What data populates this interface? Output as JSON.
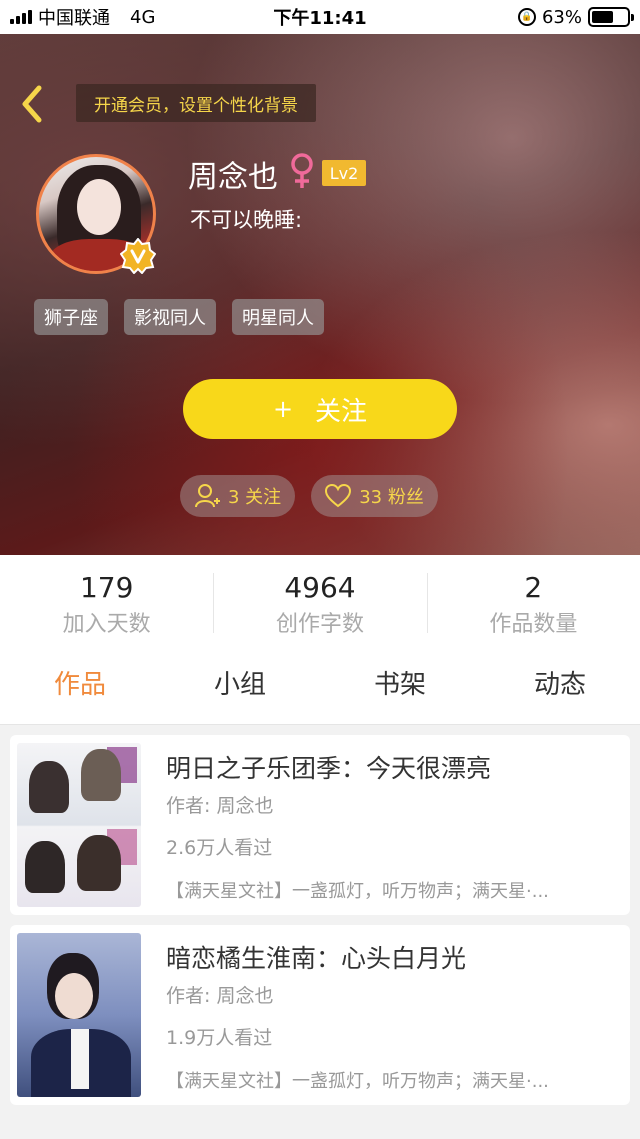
{
  "status_bar": {
    "carrier": "中国联通",
    "network": "4G",
    "time": "下午11:41",
    "battery_pct": "63%",
    "battery_level": 0.63
  },
  "header": {
    "vip_banner": "开通会员，设置个性化背景",
    "username": "周念也",
    "level": "Lv2",
    "signature": "不可以晚睡:",
    "tags": [
      "狮子座",
      "影视同人",
      "明星同人"
    ],
    "follow_label": "关注",
    "follow_plus": "+",
    "following_count": "3 关注",
    "fans_count": "33 粉丝"
  },
  "stats": [
    {
      "value": "179",
      "label": "加入天数"
    },
    {
      "value": "4964",
      "label": "创作字数"
    },
    {
      "value": "2",
      "label": "作品数量"
    }
  ],
  "tabs": [
    "作品",
    "小组",
    "书架",
    "动态"
  ],
  "works": [
    {
      "title": "明日之子乐团季：今天很漂亮",
      "author": "作者: 周念也",
      "views": "2.6万人看过",
      "desc": "【满天星文社】一盏孤灯，听万物声；满天星·..."
    },
    {
      "title": "暗恋橘生淮南：心头白月光",
      "author": "作者: 周念也",
      "views": "1.9万人看过",
      "desc": "【满天星文社】一盏孤灯，听万物声；满天星·..."
    }
  ],
  "colors": {
    "accent_yellow": "#f8d81a",
    "active_tab": "#f08a3c",
    "vip_text": "#f6d64a",
    "gender_pink": "#f06a9a"
  },
  "icons": {
    "back": "chevron-left-icon",
    "gender": "female-icon",
    "verified": "v-badge-icon",
    "following": "user-plus-icon",
    "fans": "heart-icon"
  }
}
